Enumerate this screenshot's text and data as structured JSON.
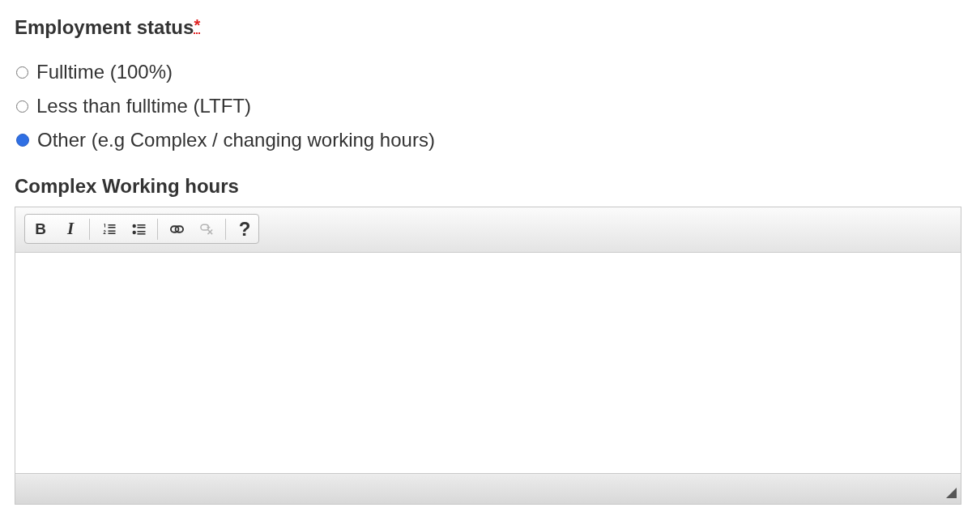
{
  "employment_status": {
    "label": "Employment status",
    "required_mark": "*",
    "options": [
      {
        "label": "Fulltime (100%)",
        "selected": false
      },
      {
        "label": "Less than fulltime (LTFT)",
        "selected": false
      },
      {
        "label": "Other (e.g Complex / changing working hours)",
        "selected": true
      }
    ]
  },
  "complex_working_hours": {
    "label": "Complex Working hours",
    "editor": {
      "toolbar": {
        "groups": [
          {
            "buttons": [
              {
                "kind": "bold",
                "label": "B",
                "disabled": false
              },
              {
                "kind": "italic",
                "label": "I",
                "disabled": false
              }
            ]
          },
          {
            "buttons": [
              {
                "kind": "numbered-list",
                "disabled": false
              },
              {
                "kind": "bulleted-list",
                "disabled": false
              }
            ]
          },
          {
            "buttons": [
              {
                "kind": "link",
                "disabled": false
              },
              {
                "kind": "unlink",
                "disabled": true
              }
            ]
          },
          {
            "buttons": [
              {
                "kind": "help",
                "label": "?",
                "disabled": false
              }
            ]
          }
        ]
      }
    }
  }
}
